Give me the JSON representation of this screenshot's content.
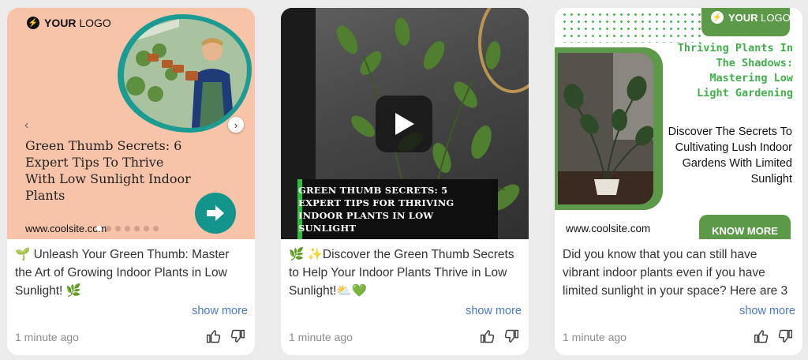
{
  "cards": [
    {
      "logo": {
        "bold": "YOUR",
        "rest": " LOGO"
      },
      "headline": "Green Thumb Secrets: 6 Expert Tips To Thrive With Low Sunlight Indoor Plants",
      "site": "www.coolsite.com",
      "caption": "🌱 Unleash Your Green Thumb: Master the Art of Growing Indoor Plants in Low Sunlight! 🌿",
      "show_more": "show more",
      "time": "1 minute ago"
    },
    {
      "banner": "GREEN THUMB SECRETS: 5 EXPERT TIPS FOR THRIVING INDOOR PLANTS IN LOW SUNLIGHT",
      "caption": "🌿 ✨Discover the Green Thumb Secrets to Help Your Indoor Plants Thrive in Low Sunlight!⛅💚",
      "show_more": "show more",
      "time": "1 minute ago"
    },
    {
      "logo": {
        "bold": "YOUR",
        "rest": " LOGO"
      },
      "heading": "Thriving Plants In The Shadows: Mastering Low Light Gardening",
      "subheading": "Discover The Secrets To Cultivating Lush Indoor Gardens With Limited Sunlight",
      "site": "www.coolsite.com",
      "cta": "KNOW MORE",
      "caption": "Did you know that you can still have vibrant indoor plants even if you have limited sunlight in your space? Here are 3",
      "show_more": "show more",
      "time": "1 minute ago"
    }
  ],
  "icons": {
    "logo": "bolt-icon",
    "prev": "chevron-left-icon",
    "next": "chevron-right-icon",
    "cta": "arrow-right-icon",
    "play": "play-icon",
    "like": "thumbs-up-icon",
    "dislike": "thumbs-down-icon"
  },
  "colors": {
    "card1_bg": "#f8c4a9",
    "teal": "#13958c",
    "green_accent": "#3fb04a",
    "green_frame": "#5c9a49",
    "link": "#4a78c8"
  }
}
